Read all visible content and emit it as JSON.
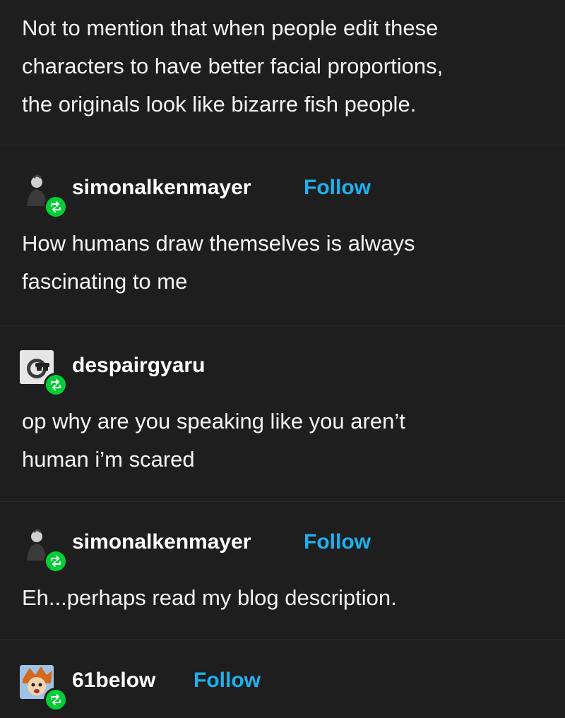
{
  "post": {
    "body": "Not to mention that when people edit these\ncharacters to have better facial proportions,\nthe originals look like bizarre fish people."
  },
  "reblogs": [
    {
      "username": "simonalkenmayer",
      "follow_label": "Follow",
      "avatar_icon": "person-silhouette-icon",
      "text": "How humans draw themselves is always\nfascinating to me"
    },
    {
      "username": "despairgyaru",
      "avatar_icon": "sunglasses-face-icon",
      "text": "op why are you speaking like you aren’t\nhuman i’m scared"
    },
    {
      "username": "simonalkenmayer",
      "follow_label": "Follow",
      "avatar_icon": "person-silhouette-icon",
      "text": "Eh...perhaps read my blog description."
    },
    {
      "username": "61below",
      "follow_label": "Follow",
      "avatar_icon": "cartoon-character-icon"
    }
  ],
  "colors": {
    "background": "#1e1e1e",
    "divider": "#2a2a2a",
    "follow": "#1db1ef",
    "reblog_badge": "#00cf35"
  },
  "icons": {
    "reblog": "reblog-icon"
  }
}
